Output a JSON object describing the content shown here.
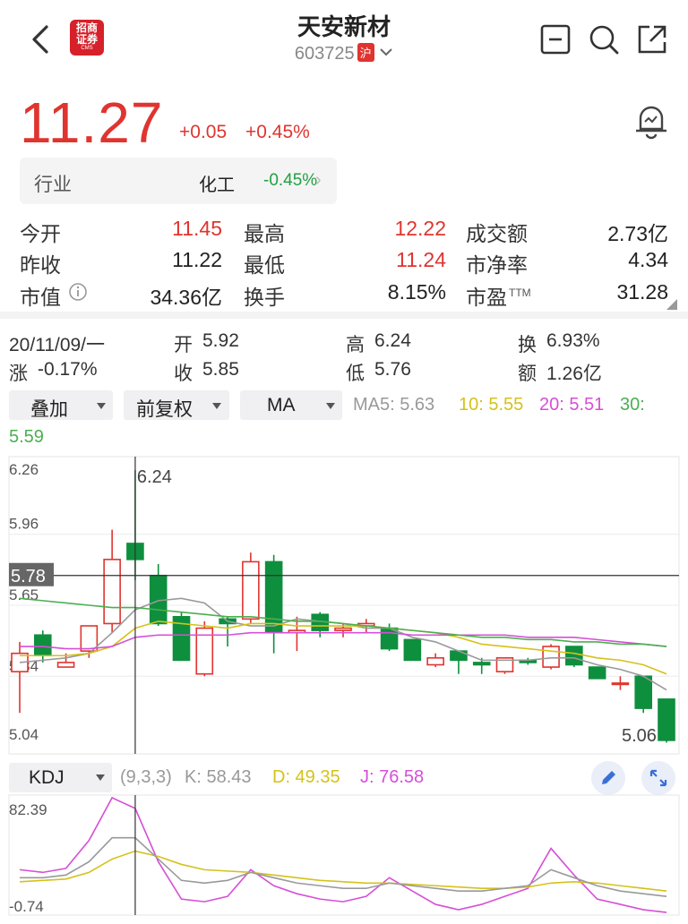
{
  "header": {
    "title": "天安新材",
    "code": "603725",
    "exchange_badge": "沪",
    "logo_text": "招商\n证券",
    "logo_sub": "CMS",
    "icons": [
      "back-arrow-icon",
      "minus-box-icon",
      "search-icon",
      "share-icon"
    ]
  },
  "quote": {
    "price": "11.27",
    "change": "+0.05",
    "change_pct": "+0.45%",
    "alert_icon": "alarm-bell-icon"
  },
  "industry": {
    "label": "行业",
    "name": "化工",
    "pct": "-0.45%"
  },
  "stats": [
    {
      "label": "今开",
      "value": "11.45",
      "color": "red"
    },
    {
      "label": "最高",
      "value": "12.22",
      "color": "red"
    },
    {
      "label": "成交额",
      "value": "2.73亿",
      "color": "dark"
    },
    {
      "label": "昨收",
      "value": "11.22",
      "color": "dark"
    },
    {
      "label": "最低",
      "value": "11.24",
      "color": "red"
    },
    {
      "label": "市净率",
      "value": "4.34",
      "color": "dark"
    },
    {
      "label": "市值",
      "value": "34.36亿",
      "color": "dark"
    },
    {
      "label": "换手",
      "value": "8.15%",
      "color": "dark"
    },
    {
      "label": "市盈",
      "value": "31.28",
      "color": "dark"
    }
  ],
  "pe_sup": "TTM",
  "day": {
    "date": "20/11/09/一",
    "open_label": "开",
    "open": "5.92",
    "high_label": "高",
    "high": "6.24",
    "turn_label": "换",
    "turn": "6.93%",
    "chg_label": "涨",
    "chg": "-0.17%",
    "close_label": "收",
    "close": "5.85",
    "low_label": "低",
    "low": "5.76",
    "amt_label": "额",
    "amt": "1.26亿"
  },
  "toolbar": {
    "overlay": "叠加",
    "adjust": "前复权",
    "indicator": "MA",
    "ma5": "MA5: 5.63",
    "ma10": "10: 5.55",
    "ma20": "20: 5.51",
    "ma30": "30:",
    "ma30_val": "5.59"
  },
  "colors": {
    "up": "#e0342f",
    "down": "#0e8f3e",
    "ma5": "#999999",
    "ma10": "#d4c21a",
    "ma20": "#d64fd6",
    "ma30": "#4caf50"
  },
  "chart_data": {
    "type": "candlestick",
    "y_ticks": [
      "6.26",
      "5.96",
      "5.65",
      "5.34",
      "5.04"
    ],
    "ylim": [
      5.04,
      6.26
    ],
    "crosshair_price": "5.78",
    "high_marker": "6.24",
    "low_marker": "5.06",
    "candles": [
      {
        "o": 5.36,
        "c": 5.44,
        "h": 5.49,
        "l": 5.18
      },
      {
        "o": 5.52,
        "c": 5.43,
        "h": 5.54,
        "l": 5.4
      },
      {
        "o": 5.38,
        "c": 5.4,
        "h": 5.44,
        "l": 5.38
      },
      {
        "o": 5.45,
        "c": 5.56,
        "h": 5.56,
        "l": 5.42
      },
      {
        "o": 5.57,
        "c": 5.85,
        "h": 5.98,
        "l": 5.53
      },
      {
        "o": 5.92,
        "c": 5.85,
        "h": 6.24,
        "l": 5.76
      },
      {
        "o": 5.78,
        "c": 5.57,
        "h": 5.83,
        "l": 5.56
      },
      {
        "o": 5.6,
        "c": 5.41,
        "h": 5.62,
        "l": 5.41
      },
      {
        "o": 5.35,
        "c": 5.55,
        "h": 5.58,
        "l": 5.34
      },
      {
        "o": 5.59,
        "c": 5.57,
        "h": 5.6,
        "l": 5.47
      },
      {
        "o": 5.59,
        "c": 5.84,
        "h": 5.88,
        "l": 5.57
      },
      {
        "o": 5.84,
        "c": 5.53,
        "h": 5.87,
        "l": 5.44
      },
      {
        "o": 5.53,
        "c": 5.54,
        "h": 5.6,
        "l": 5.45
      },
      {
        "o": 5.61,
        "c": 5.54,
        "h": 5.62,
        "l": 5.51
      },
      {
        "o": 5.54,
        "c": 5.55,
        "h": 5.57,
        "l": 5.51
      },
      {
        "o": 5.56,
        "c": 5.57,
        "h": 5.59,
        "l": 5.53
      },
      {
        "o": 5.55,
        "c": 5.46,
        "h": 5.57,
        "l": 5.45
      },
      {
        "o": 5.5,
        "c": 5.41,
        "h": 5.5,
        "l": 5.41
      },
      {
        "o": 5.39,
        "c": 5.42,
        "h": 5.44,
        "l": 5.38
      },
      {
        "o": 5.45,
        "c": 5.41,
        "h": 5.45,
        "l": 5.35
      },
      {
        "o": 5.4,
        "c": 5.39,
        "h": 5.42,
        "l": 5.35
      },
      {
        "o": 5.36,
        "c": 5.42,
        "h": 5.42,
        "l": 5.35
      },
      {
        "o": 5.41,
        "c": 5.4,
        "h": 5.42,
        "l": 5.39
      },
      {
        "o": 5.38,
        "c": 5.47,
        "h": 5.48,
        "l": 5.37
      },
      {
        "o": 5.47,
        "c": 5.39,
        "h": 5.47,
        "l": 5.38
      },
      {
        "o": 5.38,
        "c": 5.33,
        "h": 5.38,
        "l": 5.33
      },
      {
        "o": 5.31,
        "c": 5.31,
        "h": 5.34,
        "l": 5.28
      },
      {
        "o": 5.34,
        "c": 5.2,
        "h": 5.34,
        "l": 5.18
      },
      {
        "o": 5.24,
        "c": 5.06,
        "h": 5.24,
        "l": 5.05
      }
    ],
    "series": [
      {
        "name": "MA5",
        "values": [
          5.4,
          5.41,
          5.42,
          5.44,
          5.53,
          5.63,
          5.67,
          5.68,
          5.66,
          5.58,
          5.56,
          5.56,
          5.59,
          5.58,
          5.57,
          5.55,
          5.55,
          5.51,
          5.49,
          5.45,
          5.41,
          5.41,
          5.41,
          5.42,
          5.42,
          5.39,
          5.37,
          5.34,
          5.28
        ]
      },
      {
        "name": "10",
        "values": [
          5.43,
          5.43,
          5.43,
          5.44,
          5.47,
          5.55,
          5.58,
          5.57,
          5.56,
          5.55,
          5.57,
          5.57,
          5.56,
          5.56,
          5.56,
          5.56,
          5.55,
          5.54,
          5.53,
          5.51,
          5.48,
          5.47,
          5.46,
          5.45,
          5.44,
          5.42,
          5.41,
          5.39,
          5.35
        ]
      },
      {
        "name": "20",
        "values": [
          5.47,
          5.47,
          5.46,
          5.46,
          5.47,
          5.51,
          5.52,
          5.52,
          5.52,
          5.52,
          5.53,
          5.53,
          5.53,
          5.53,
          5.53,
          5.53,
          5.53,
          5.52,
          5.52,
          5.52,
          5.52,
          5.52,
          5.51,
          5.51,
          5.51,
          5.5,
          5.49,
          5.48,
          5.47
        ]
      },
      {
        "name": "30",
        "values": [
          5.68,
          5.67,
          5.66,
          5.65,
          5.64,
          5.64,
          5.63,
          5.62,
          5.61,
          5.6,
          5.6,
          5.59,
          5.58,
          5.58,
          5.57,
          5.56,
          5.55,
          5.54,
          5.53,
          5.52,
          5.51,
          5.51,
          5.5,
          5.5,
          5.49,
          5.49,
          5.48,
          5.48,
          5.47
        ]
      }
    ]
  },
  "kdj": {
    "label": "KDJ",
    "params": "(9,3,3)",
    "k": "K: 58.43",
    "d": "D: 49.35",
    "j": "J: 76.58",
    "y_top": "82.39",
    "y_bottom": "-0.74",
    "ylim": [
      -0.74,
      82.39
    ],
    "edit_icon": "pencil-icon",
    "expand_icon": "expand-icon",
    "k_values": [
      28,
      28,
      30,
      40,
      58,
      58,
      42,
      26,
      24,
      26,
      32,
      28,
      24,
      22,
      20,
      20,
      24,
      22,
      20,
      18,
      18,
      20,
      22,
      34,
      28,
      22,
      18,
      16,
      14
    ],
    "d_values": [
      25,
      26,
      27,
      32,
      42,
      48,
      44,
      38,
      34,
      33,
      32,
      30,
      28,
      26,
      25,
      24,
      24,
      23,
      22,
      21,
      20,
      20,
      21,
      24,
      25,
      24,
      22,
      20,
      18
    ],
    "j_values": [
      34,
      32,
      35,
      56,
      88,
      80,
      40,
      12,
      10,
      14,
      34,
      22,
      16,
      12,
      10,
      14,
      28,
      18,
      8,
      4,
      8,
      14,
      20,
      50,
      30,
      12,
      8,
      4,
      2
    ]
  }
}
